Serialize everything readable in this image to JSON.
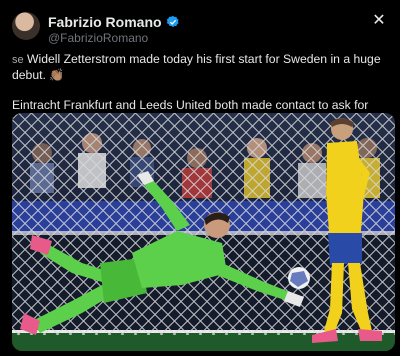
{
  "author": {
    "display_name": "Fabrizio Romano",
    "handle": "@FabrizioRomano",
    "verified_icon": "verified-badge-icon",
    "avatar_icon": "profile-photo"
  },
  "close_icon": "close-icon",
  "tweet": {
    "line1_prefix": "se",
    "line1_text": "Widell Zetterstrom made today his first start for Sweden in a huge debut.",
    "line1_emoji": "👏🏽",
    "line2_text": "Eintracht Frankfurt and Leeds United both made contact to ask for price recently, as Wolves too."
  },
  "media": {
    "description_icon": "football-goalkeeper-photo",
    "colors": {
      "pitch": "#1f5a2a",
      "net": "#d8d8d8",
      "keeper": "#5cd04a",
      "sweden_yellow": "#f2d11c",
      "sweden_blue": "#2a4aa8"
    }
  },
  "colors": {
    "background": "#000000",
    "text": "#e7e9ea",
    "muted": "#71767b",
    "verified": "#1d9bf0"
  }
}
